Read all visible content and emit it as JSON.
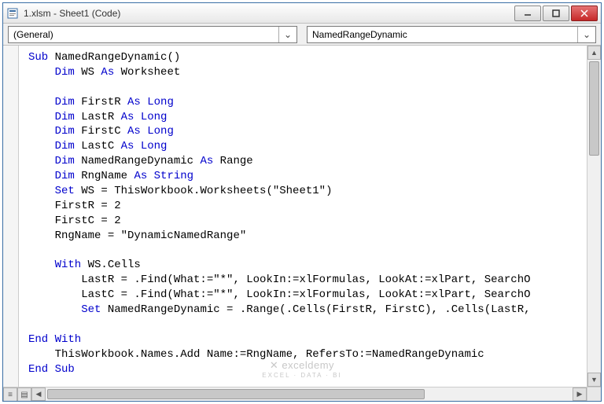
{
  "titlebar": {
    "title": "1.xlsm - Sheet1 (Code)"
  },
  "dropdowns": {
    "object": "(General)",
    "procedure": "NamedRangeDynamic"
  },
  "code": {
    "l01a": "Sub",
    "l01b": " NamedRangeDynamic()",
    "l02a": "    Dim",
    "l02b": " WS ",
    "l02c": "As",
    "l02d": " Worksheet",
    "l03": "",
    "l04a": "    Dim",
    "l04b": " FirstR ",
    "l04c": "As",
    "l04d": " ",
    "l04e": "Long",
    "l05a": "    Dim",
    "l05b": " LastR ",
    "l05c": "As",
    "l05d": " ",
    "l05e": "Long",
    "l06a": "    Dim",
    "l06b": " FirstC ",
    "l06c": "As",
    "l06d": " ",
    "l06e": "Long",
    "l07a": "    Dim",
    "l07b": " LastC ",
    "l07c": "As",
    "l07d": " ",
    "l07e": "Long",
    "l08a": "    Dim",
    "l08b": " NamedRangeDynamic ",
    "l08c": "As",
    "l08d": " Range",
    "l09a": "    Dim",
    "l09b": " RngName ",
    "l09c": "As",
    "l09d": " ",
    "l09e": "String",
    "l10a": "    Set",
    "l10b": " WS = ThisWorkbook.Worksheets(\"Sheet1\")",
    "l11": "    FirstR = 2",
    "l12": "    FirstC = 2",
    "l13": "    RngName = \"DynamicNamedRange\"",
    "l14": "",
    "l15a": "    With",
    "l15b": " WS.Cells",
    "l16": "        LastR = .Find(What:=\"*\", LookIn:=xlFormulas, LookAt:=xlPart, SearchO",
    "l17": "        LastC = .Find(What:=\"*\", LookIn:=xlFormulas, LookAt:=xlPart, SearchO",
    "l18a": "        Set",
    "l18b": " NamedRangeDynamic = .Range(.Cells(FirstR, FirstC), .Cells(LastR,",
    "l19": "",
    "l20a": "End With",
    "l21": "    ThisWorkbook.Names.Add Name:=RngName, RefersTo:=NamedRangeDynamic",
    "l22a": "End Sub"
  },
  "watermark": {
    "main": "✕ exceldemy",
    "sub": "EXCEL · DATA · BI"
  }
}
